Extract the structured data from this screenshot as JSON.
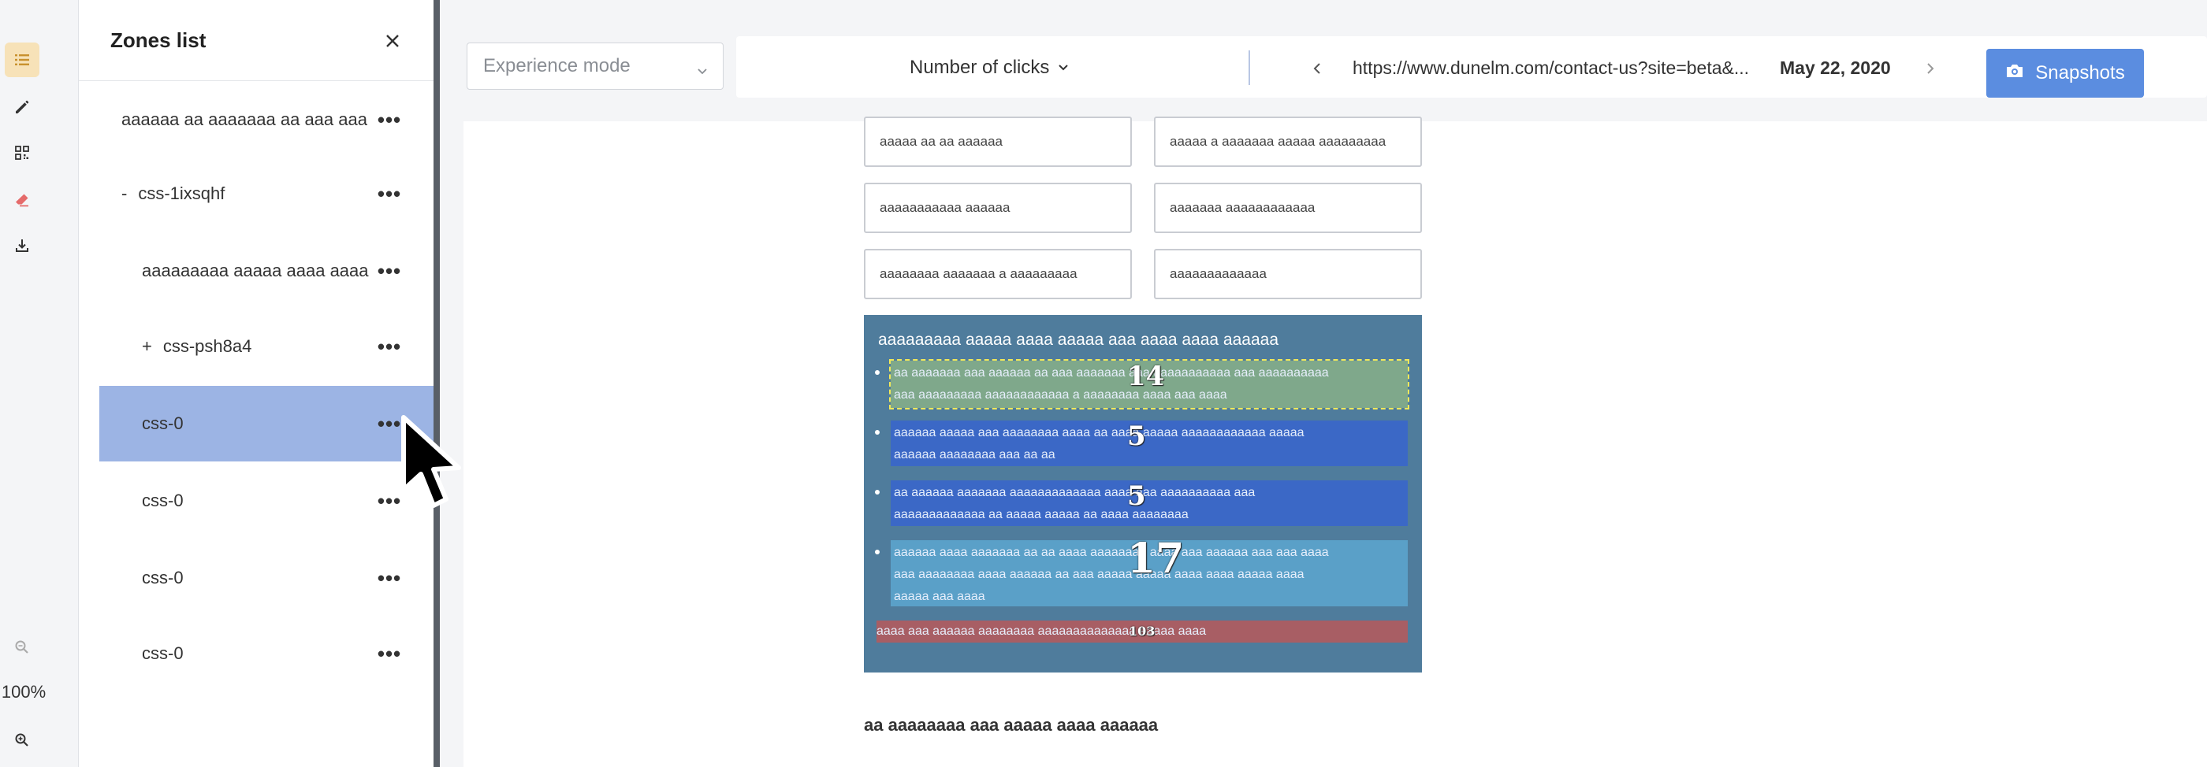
{
  "rail": {
    "icons": [
      "list-icon",
      "pencil-icon",
      "qr-icon",
      "eraser-icon",
      "download-icon"
    ],
    "zoom_label": "100%"
  },
  "zones_panel": {
    "title": "Zones list",
    "items": [
      {
        "prefix": "",
        "label": "aaaaaa aa aaaaaaa aa aaa aaa",
        "selected": false
      },
      {
        "prefix": "-",
        "label": "css-1ixsqhf",
        "selected": false
      },
      {
        "prefix": "",
        "label": "aaaaaaaaa aaaaa aaaa aaaa",
        "selected": false
      },
      {
        "prefix": "+",
        "label": "css-psh8a4",
        "selected": false
      },
      {
        "prefix": "",
        "label": "css-0",
        "selected": true
      },
      {
        "prefix": "",
        "label": "css-0",
        "selected": false
      },
      {
        "prefix": "",
        "label": "css-0",
        "selected": false
      },
      {
        "prefix": "",
        "label": "css-0",
        "selected": false
      }
    ],
    "more_label": "•••"
  },
  "toolbar": {
    "mode_placeholder": "Experience mode",
    "metric_label": "Number of clicks",
    "url": "https://www.dunelm.com/contact-us?site=beta&...",
    "date": "May 22, 2020",
    "snapshots_label": "Snapshots"
  },
  "page": {
    "fields": [
      "aaaaa aa aa aaaaaa",
      "aaaaa a aaaaaaa aaaaa aaaaaaaaa",
      "aaaaaaaaaaa aaaaaa",
      "aaaaaaa aaaaaaaaaaaa",
      "aaaaaaaa aaaaaaa a aaaaaaaaa",
      "aaaaaaaaaaaaa"
    ],
    "heatmap_heading": "aaaaaaaaa aaaaa aaaa aaaaa aaa aaaa aaaa aaaaaa",
    "zones": [
      {
        "lines": [
          "aa aaaaaaa aaa aaaaaa aa aaa aaaaaaa aaa aaaaaaaaaaa aaa aaaaaaaaaa",
          "aaa aaaaaaaaa aaaaaaaaaaaa a aaaaaaaa aaaa aaa aaaa"
        ],
        "count": "14",
        "color": "#7fa88b"
      },
      {
        "lines": [
          "aaaaaa aaaaa aaa aaaaaaaa aaaa aa aaaa aaaaa aaaaaaaaaaaa aaaaa",
          "aaaaaa aaaaaaaa aaa aa aa"
        ],
        "count": "5",
        "color": "#3b68c6"
      },
      {
        "lines": [
          "aa aaaaaa aaaaaaa aaaaaaaaaaaaa aaaa aaa aaaaaaaaaa aaa",
          "aaaaaaaaaaaaa aa aaaaa aaaaa aa aaaa aaaaaaaa"
        ],
        "count": "5",
        "color": "#3b68c6"
      },
      {
        "lines": [
          "aaaaaa aaaa aaaaaaa aa aa aaaa aaaaaaaa aaaa aaa aaaaaa aaa aaa aaaa",
          "aaa aaaaaaaa aaaa aaaaaa aa aaa aaaaa aaaaa aaaa aaaa aaaaa aaaa",
          "aaaaa aaa aaaa"
        ],
        "count": "17",
        "color": "#5aa0c8"
      },
      {
        "lines": [
          "aaaa aaa aaaaaa aaaaaaaa aaaaaaaaaaaaaa aaaaa aaaa"
        ],
        "count": "103",
        "color": "#a85e64"
      }
    ],
    "bottom_text": "aa aaaaaaaa aaa aaaaa aaaa aaaaaa"
  }
}
